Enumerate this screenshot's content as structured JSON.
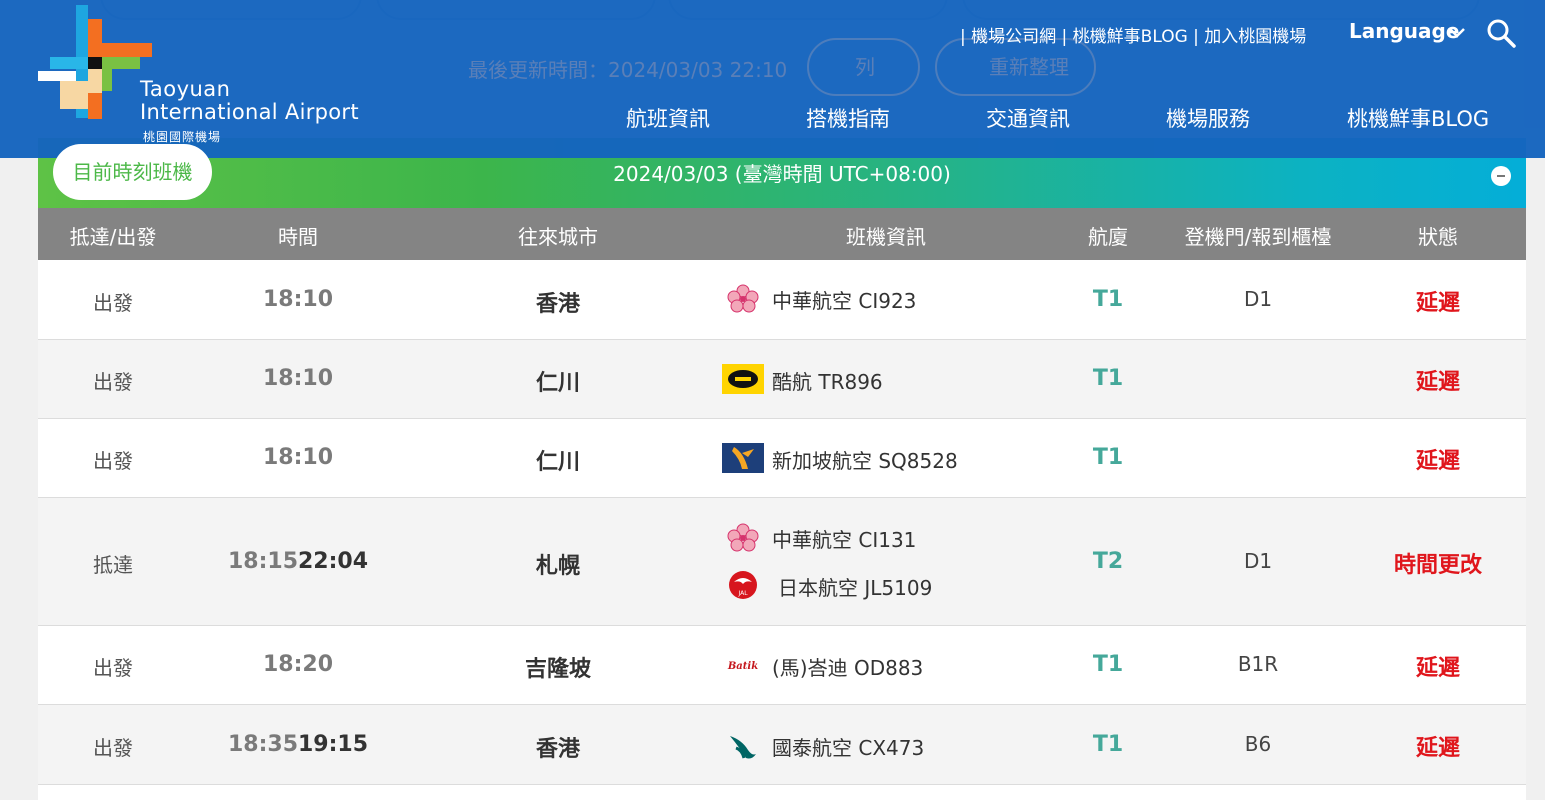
{
  "header": {
    "logo": {
      "line1": "Taoyuan",
      "line2": "International Airport",
      "line3": "桃園國際機場"
    },
    "stale_update": "最後更新時間：2024/03/03 22:10",
    "print_label": "列印",
    "refresh_label": "重新整理",
    "top_links": "| 機場公司網 | 桃機鮮事BLOG | 加入桃園機場",
    "language": "Language",
    "nav": [
      "航班資訊",
      "搭機指南",
      "交通資訊",
      "機場服務",
      "桃機鮮事BLOG"
    ]
  },
  "band": {
    "tab_label": "目前時刻班機",
    "date_label": "2024/03/03 (臺灣時間 UTC+08:00)"
  },
  "table": {
    "headers": [
      "抵達/出發",
      "時間",
      "往來城市",
      "班機資訊",
      "航廈",
      "登機門/報到櫃檯",
      "狀態"
    ],
    "rows": [
      {
        "type": "出發",
        "time": "18:10",
        "new_time": "",
        "city": "香港",
        "flights": [
          {
            "airline": "中華航空 CI923",
            "logo": "plum-blossom-icon"
          }
        ],
        "terminal": "T1",
        "gate": "D1",
        "status": "延遲"
      },
      {
        "type": "出發",
        "time": "18:10",
        "new_time": "",
        "city": "仁川",
        "flights": [
          {
            "airline": "酷航 TR896",
            "logo": "scoot-logo"
          }
        ],
        "terminal": "T1",
        "gate": "",
        "status": "延遲"
      },
      {
        "type": "出發",
        "time": "18:10",
        "new_time": "",
        "city": "仁川",
        "flights": [
          {
            "airline": "新加坡航空 SQ8528",
            "logo": "singapore-bird-logo"
          }
        ],
        "terminal": "T1",
        "gate": "",
        "status": "延遲"
      },
      {
        "type": "抵達",
        "time": "18:15",
        "new_time": "22:04",
        "city": "札幌",
        "flights": [
          {
            "airline": "中華航空 CI131",
            "logo": "plum-blossom-icon"
          },
          {
            "airline": "日本航空 JL5109",
            "logo": "jal-crane-logo"
          }
        ],
        "terminal": "T2",
        "gate": "D1",
        "status": "時間更改"
      },
      {
        "type": "出發",
        "time": "18:20",
        "new_time": "",
        "city": "吉隆坡",
        "flights": [
          {
            "airline": "(馬)峇迪 OD883",
            "logo": "batik-air-logo"
          }
        ],
        "terminal": "T1",
        "gate": "B1R",
        "status": "延遲"
      },
      {
        "type": "出發",
        "time": "18:35",
        "new_time": "19:15",
        "city": "香港",
        "flights": [
          {
            "airline": "國泰航空 CX473",
            "logo": "cathay-brushwing-logo"
          }
        ],
        "terminal": "T1",
        "gate": "B6",
        "status": "延遲"
      }
    ]
  },
  "colors": {
    "header_blue": "#1564be",
    "status_red": "#e0161c",
    "terminal_teal": "#45a89a",
    "band_green": "#4cb848"
  }
}
